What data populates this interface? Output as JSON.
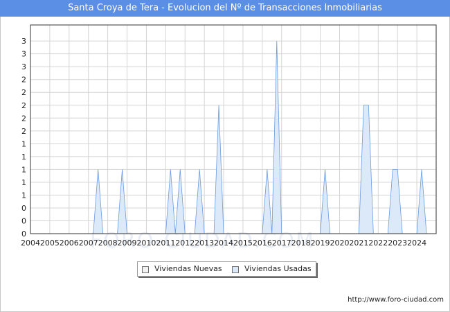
{
  "title": "Santa Croya de Tera - Evolucion del Nº de Transacciones Inmobiliarias",
  "footer_url": "http://www.foro-ciudad.com",
  "watermark": "FORO-CIUDAD.COM",
  "colors": {
    "title_bg": "#5b8fe6",
    "usadas_fill": "#dbe9f8",
    "usadas_stroke": "#6c9be0",
    "nuevas_fill": "#f2f2f2",
    "grid": "#d4d4d4"
  },
  "legend": [
    {
      "label": "Viviendas Nuevas",
      "color": "#f2f2f2"
    },
    {
      "label": "Viviendas Usadas",
      "color": "#dbe9f8"
    }
  ],
  "chart_data": {
    "type": "area",
    "title": "Santa Croya de Tera - Evolucion del Nº de Transacciones Inmobiliarias",
    "xlabel": "",
    "ylabel": "",
    "xlim": [
      2004,
      2025
    ],
    "ylim": [
      0,
      3.25
    ],
    "x_ticks": [
      "2004",
      "2005",
      "2006",
      "2007",
      "2008",
      "2009",
      "2010",
      "2011",
      "2012",
      "2013",
      "2014",
      "2015",
      "2016",
      "2017",
      "2018",
      "2019",
      "2020",
      "2021",
      "2022",
      "2023",
      "2024"
    ],
    "y_ticks": [
      "0",
      "0",
      "0",
      "1",
      "1",
      "1",
      "1",
      "1",
      "2",
      "2",
      "2",
      "2",
      "2",
      "3",
      "3",
      "3"
    ],
    "grid": true,
    "legend_position": "bottom",
    "series": [
      {
        "name": "Viviendas Nuevas",
        "points": []
      },
      {
        "name": "Viviendas Usadas",
        "points": [
          [
            2004.0,
            0
          ],
          [
            2007.25,
            0
          ],
          [
            2007.5,
            1
          ],
          [
            2007.75,
            0
          ],
          [
            2008.5,
            0
          ],
          [
            2008.75,
            1
          ],
          [
            2009.0,
            0
          ],
          [
            2011.0,
            0
          ],
          [
            2011.25,
            1
          ],
          [
            2011.5,
            0
          ],
          [
            2011.75,
            1
          ],
          [
            2012.0,
            0
          ],
          [
            2012.5,
            0
          ],
          [
            2012.75,
            1
          ],
          [
            2013.0,
            0
          ],
          [
            2013.5,
            0
          ],
          [
            2013.75,
            2
          ],
          [
            2014.0,
            0
          ],
          [
            2016.0,
            0
          ],
          [
            2016.25,
            1
          ],
          [
            2016.5,
            0
          ],
          [
            2016.75,
            3
          ],
          [
            2017.0,
            0
          ],
          [
            2019.0,
            0
          ],
          [
            2019.25,
            1
          ],
          [
            2019.5,
            0
          ],
          [
            2021.0,
            0
          ],
          [
            2021.25,
            2
          ],
          [
            2021.5,
            2
          ],
          [
            2021.75,
            0
          ],
          [
            2022.5,
            0
          ],
          [
            2022.75,
            1
          ],
          [
            2023.0,
            1
          ],
          [
            2023.25,
            0
          ],
          [
            2024.0,
            0
          ],
          [
            2024.25,
            1
          ],
          [
            2024.5,
            0
          ],
          [
            2024.75,
            0
          ]
        ]
      }
    ]
  }
}
